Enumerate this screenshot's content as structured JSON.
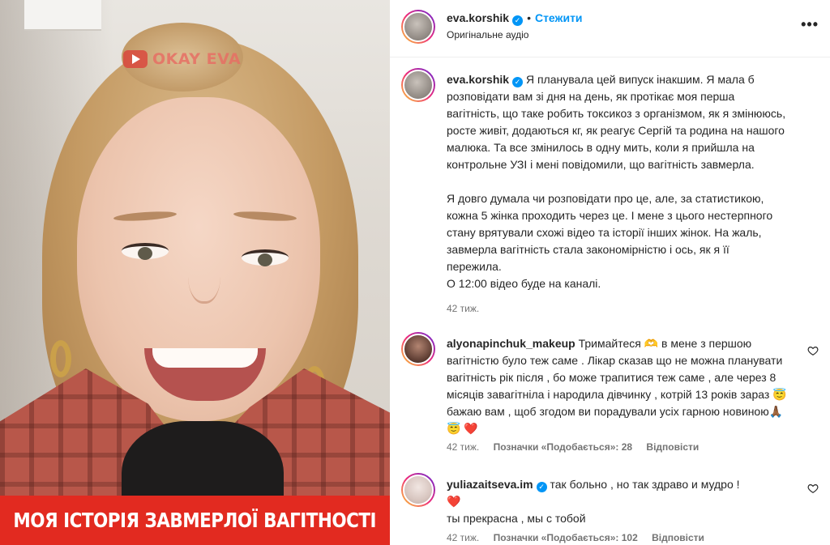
{
  "video": {
    "watermark": "OKAY EVA",
    "banner": "МОЯ ІСТОРІЯ ЗАВМЕРЛОЇ ВАГІТНОСТІ"
  },
  "header": {
    "username": "eva.korshik",
    "separator": "•",
    "follow_label": "Стежити",
    "audio": "Оригінальне аудіо",
    "more_icon": "more-horizontal-icon"
  },
  "caption": {
    "username": "eva.korshik",
    "paragraph1": "Я планувала цей випуск інакшим. Я мала б розповідати вам зі дня на день, як протікає моя перша вагітність, що таке робить токсикоз з організмом, як я змінююсь, росте живіт, додаються кг, як реагує Сергій та родина на нашого малюка. Та все змінилось в одну мить, коли я прийшла на контрольне УЗІ і мені повідомили, що вагітність завмерла.",
    "paragraph2": "Я довго думала чи розповідати про це, але, за статистикою, кожна 5 жінка проходить через це. І мене з цього нестерпного стану врятували схожі відео та історії інших жінок. На жаль, завмерла вагітність стала закономірністю і ось, як я її пережила.",
    "paragraph3": "О 12:00 відео буде на каналі.",
    "time": "42 тиж."
  },
  "comments": [
    {
      "username": "alyonapinchuk_makeup",
      "text": "Тримайтеся 🫶 в мене з першою вагітністю було теж саме . Лікар сказав що не можна планувати вагітність рік після , бо може трапитися теж саме , але через 8 місяців завагітніла і народила дівчинку , котрій 13 років зараз 😇 бажаю вам , щоб згодом ви порадували усіх гарною новиною🙏🏾 😇 ❤️",
      "time": "42 тиж.",
      "likes": "Позначки «Подобається»: 28",
      "reply": "Відповісти"
    },
    {
      "username": "yuliazaitseva.im",
      "text": "так больно , но так здраво и мудро !",
      "text2": "❤️",
      "text3": "ты прекрасна , мы с тобой",
      "time": "42 тиж.",
      "likes": "Позначки «Подобається»: 102",
      "reply": "Відповісти"
    }
  ],
  "colors": {
    "accent": "#0095f6",
    "banner": "#e22a20",
    "muted": "#737373"
  }
}
